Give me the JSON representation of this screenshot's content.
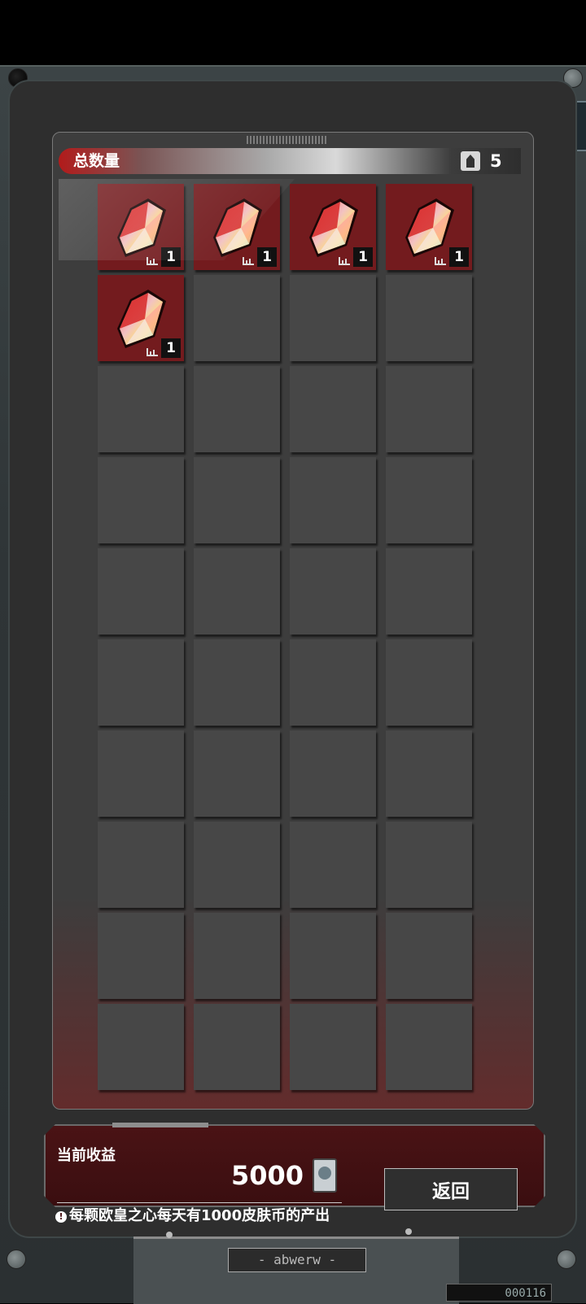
{
  "header": {
    "title": "总数量",
    "count": "5"
  },
  "items": [
    {
      "filled": true,
      "quantity": "1"
    },
    {
      "filled": true,
      "quantity": "1"
    },
    {
      "filled": true,
      "quantity": "1"
    },
    {
      "filled": true,
      "quantity": "1"
    },
    {
      "filled": true,
      "quantity": "1"
    }
  ],
  "total_slots": 40,
  "footer": {
    "income_label": "当前收益",
    "income_value": "5000",
    "info_text": "每颗欧皇之心每天有1000皮肤币的产出",
    "back_label": "返回"
  },
  "device": {
    "plate_label": "- abwerw -",
    "serial": "000116"
  },
  "colors": {
    "accent_red": "#b21b1b",
    "slot_filled": "#731b1e",
    "slot_empty": "#474747"
  }
}
